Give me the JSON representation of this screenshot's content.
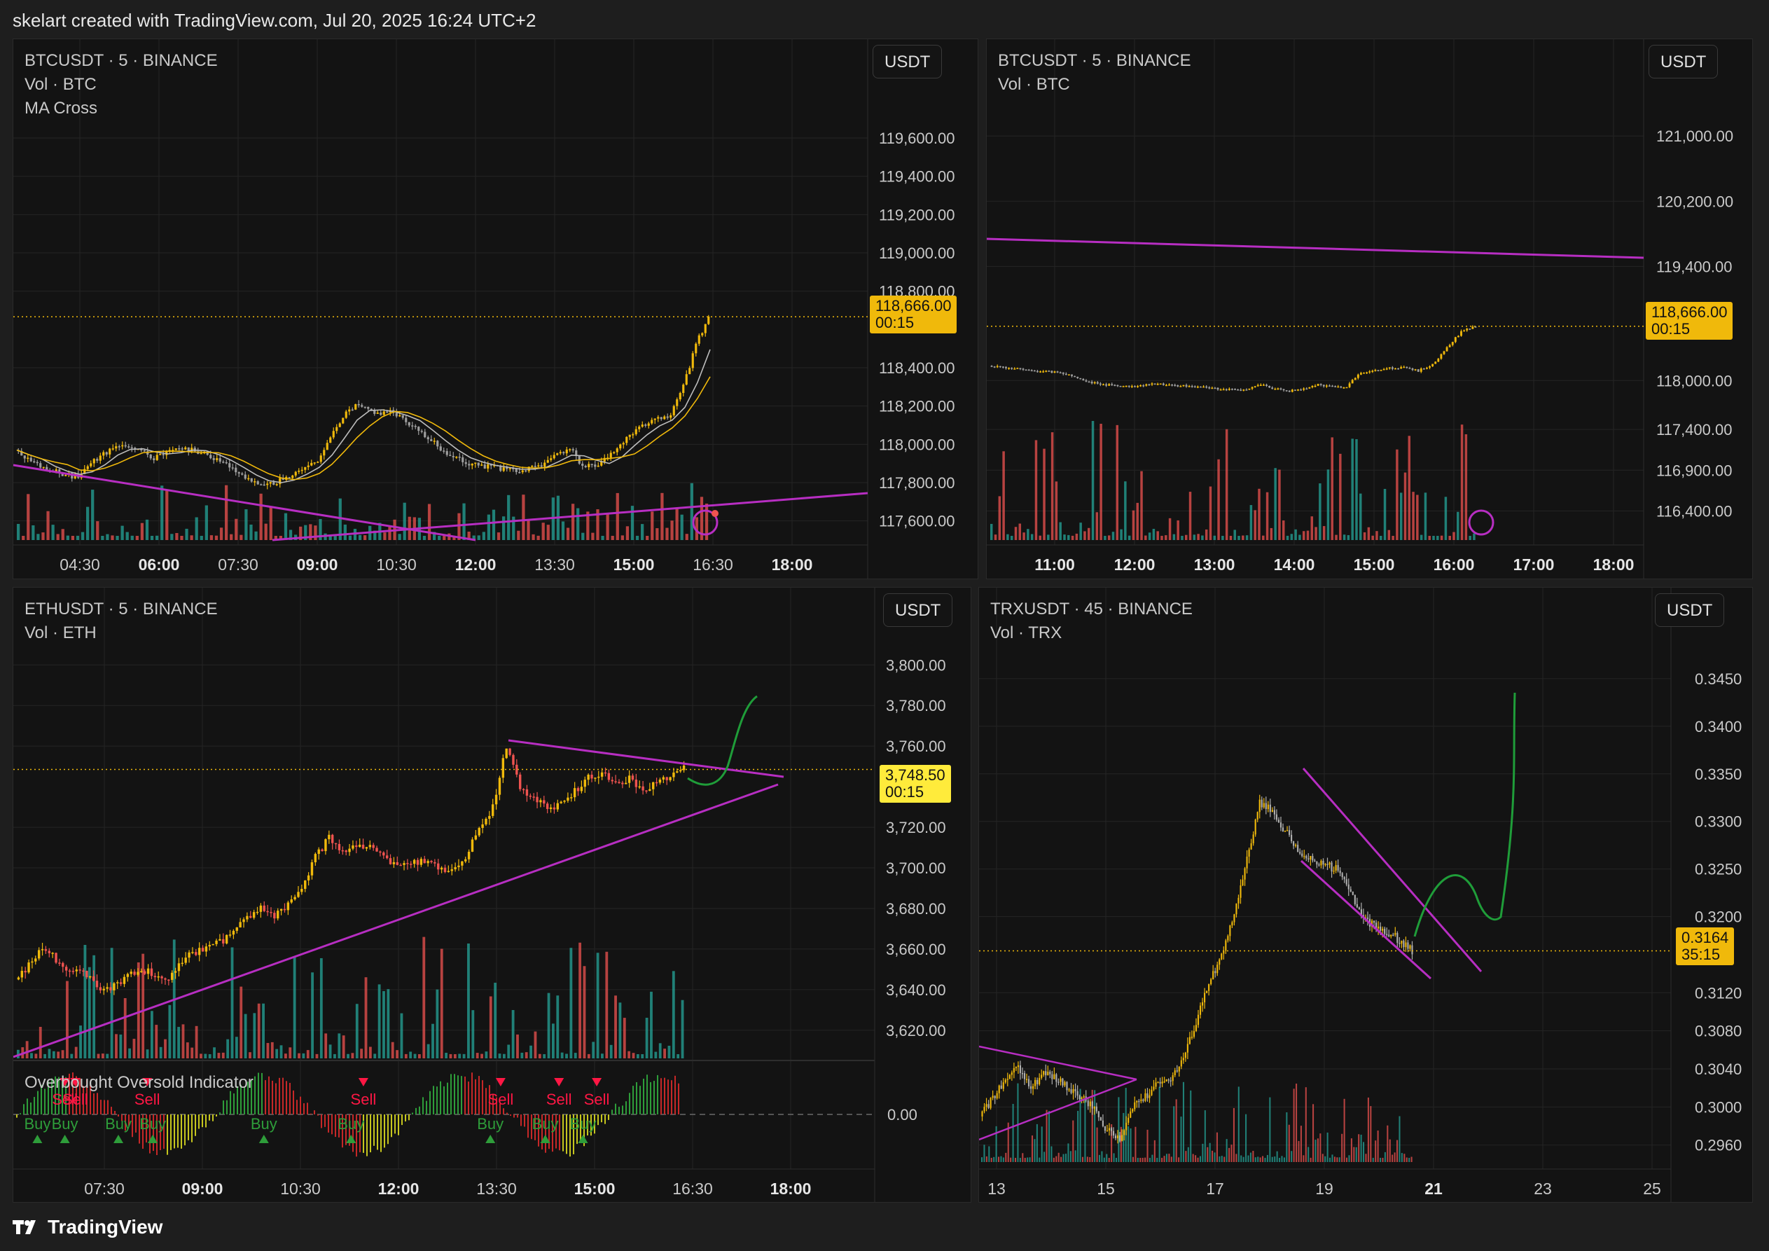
{
  "header": {
    "text": "skelart created with TradingView.com, Jul 20, 2025 16:24 UTC+2"
  },
  "footer": {
    "brand": "TradingView"
  },
  "colors": {
    "up": "#f0b90b",
    "down": "#ef5350",
    "trend": "#b72ec2",
    "green_path": "#1f9d39",
    "vol_up": "#26a69a",
    "vol_down": "#ef5350",
    "price_tag": "#f0b90b",
    "eth_tag": "#ffeb3b"
  },
  "panels": [
    {
      "id": "btc1",
      "legend": [
        "BTCUSDT · 5 · BINANCE",
        "Vol · BTC",
        "MA Cross"
      ],
      "unit": "USDT",
      "price": "118,666.00",
      "countdown": "00:15"
    },
    {
      "id": "btc2",
      "legend": [
        "BTCUSDT · 5 · BINANCE",
        "Vol · BTC"
      ],
      "unit": "USDT",
      "price": "118,666.00",
      "countdown": "00:15"
    },
    {
      "id": "eth",
      "legend": [
        "ETHUSDT · 5 · BINANCE",
        "Vol · ETH"
      ],
      "unit": "USDT",
      "price": "3,748.50",
      "countdown": "00:15",
      "oscillator_title": "Overbought Oversold Indicator",
      "oscillator_zero": "0.00"
    },
    {
      "id": "trx",
      "legend": [
        "TRXUSDT · 45 · BINANCE",
        "Vol · TRX"
      ],
      "unit": "USDT",
      "price": "0.3164",
      "countdown": "35:15"
    }
  ],
  "chart_data": [
    {
      "type": "candlestick",
      "symbol": "BTCUSDT",
      "interval": "5",
      "exchange": "BINANCE",
      "yticks": [
        "119,600.00",
        "119,400.00",
        "119,200.00",
        "119,000.00",
        "118,800.00",
        "118,400.00",
        "118,200.00",
        "118,000.00",
        "117,800.00",
        "117,600.00"
      ],
      "ylim": [
        117500,
        119750
      ],
      "xticks": [
        {
          "label": "04:30",
          "bold": false
        },
        {
          "label": "06:00",
          "bold": true
        },
        {
          "label": "07:30",
          "bold": false
        },
        {
          "label": "09:00",
          "bold": true
        },
        {
          "label": "10:30",
          "bold": false
        },
        {
          "label": "12:00",
          "bold": true
        },
        {
          "label": "13:30",
          "bold": false
        },
        {
          "label": "15:00",
          "bold": true
        },
        {
          "label": "16:30",
          "bold": false
        },
        {
          "label": "18:00",
          "bold": true
        }
      ],
      "last_price": 118666,
      "close_path": [
        117970,
        117920,
        117880,
        117860,
        117840,
        117830,
        117900,
        117950,
        117980,
        117990,
        117960,
        117930,
        117960,
        117980,
        117970,
        117950,
        117920,
        117880,
        117840,
        117800,
        117790,
        117810,
        117840,
        117880,
        117920,
        118030,
        118150,
        118200,
        118180,
        118160,
        118170,
        118120,
        118080,
        118020,
        117960,
        117930,
        117900,
        117890,
        117880,
        117870,
        117860,
        117880,
        117900,
        117950,
        117980,
        117890,
        117880,
        117930,
        117990,
        118060,
        118100,
        118130,
        118150,
        118300,
        118520,
        118666
      ]
    },
    {
      "type": "candlestick",
      "symbol": "BTCUSDT",
      "interval": "5",
      "exchange": "BINANCE",
      "yticks": [
        "121,000.00",
        "120,200.00",
        "119,400.00",
        "118,000.00",
        "117,400.00",
        "116,900.00",
        "116,400.00"
      ],
      "ylim": [
        116000,
        121500
      ],
      "xticks": [
        {
          "label": "11:00",
          "bold": true
        },
        {
          "label": "12:00",
          "bold": true
        },
        {
          "label": "13:00",
          "bold": true
        },
        {
          "label": "14:00",
          "bold": true
        },
        {
          "label": "15:00",
          "bold": true
        },
        {
          "label": "16:00",
          "bold": true
        },
        {
          "label": "17:00",
          "bold": true
        },
        {
          "label": "18:00",
          "bold": true
        }
      ],
      "last_price": 118666,
      "close_path": [
        118180,
        118160,
        118150,
        118120,
        118110,
        118100,
        118050,
        117980,
        117950,
        117940,
        117930,
        117950,
        117960,
        117940,
        117930,
        117920,
        117900,
        117890,
        117880,
        117950,
        117900,
        117870,
        117900,
        117950,
        117920,
        117930,
        118100,
        118130,
        118150,
        118160,
        118120,
        118200,
        118400,
        118600,
        118666
      ]
    },
    {
      "type": "candlestick",
      "symbol": "ETHUSDT",
      "interval": "5",
      "exchange": "BINANCE",
      "yticks": [
        "3,800.00",
        "3,780.00",
        "3,760.00",
        "3,720.00",
        "3,700.00",
        "3,680.00",
        "3,660.00",
        "3,640.00",
        "3,620.00"
      ],
      "ylim": [
        3612,
        3807
      ],
      "xticks": [
        {
          "label": "07:30",
          "bold": false
        },
        {
          "label": "09:00",
          "bold": true
        },
        {
          "label": "10:30",
          "bold": false
        },
        {
          "label": "12:00",
          "bold": true
        },
        {
          "label": "13:30",
          "bold": false
        },
        {
          "label": "15:00",
          "bold": true
        },
        {
          "label": "16:30",
          "bold": false
        },
        {
          "label": "18:00",
          "bold": true
        }
      ],
      "last_price": 3748.5,
      "close_path": [
        3645,
        3652,
        3660,
        3655,
        3650,
        3648,
        3642,
        3640,
        3645,
        3650,
        3648,
        3645,
        3652,
        3658,
        3660,
        3663,
        3668,
        3675,
        3680,
        3675,
        3683,
        3690,
        3705,
        3715,
        3708,
        3712,
        3710,
        3706,
        3700,
        3702,
        3704,
        3700,
        3698,
        3705,
        3720,
        3730,
        3760,
        3740,
        3735,
        3728,
        3732,
        3738,
        3744,
        3746,
        3741,
        3744,
        3738,
        3742,
        3745,
        3748.5
      ],
      "oscillator": {
        "title": "Overbought Oversold Indicator",
        "zero": "0.00",
        "signals": [
          {
            "type": "sell",
            "x": 0.07
          },
          {
            "type": "sell",
            "x": 0.085
          },
          {
            "type": "buy",
            "x": 0.03
          },
          {
            "type": "buy",
            "x": 0.07
          },
          {
            "type": "buy",
            "x": 0.148
          },
          {
            "type": "sell",
            "x": 0.19
          },
          {
            "type": "buy",
            "x": 0.198
          },
          {
            "type": "buy",
            "x": 0.36
          },
          {
            "type": "sell",
            "x": 0.505
          },
          {
            "type": "buy",
            "x": 0.487
          },
          {
            "type": "sell",
            "x": 0.705
          },
          {
            "type": "buy",
            "x": 0.69
          },
          {
            "type": "sell",
            "x": 0.79
          },
          {
            "type": "buy",
            "x": 0.77
          },
          {
            "type": "sell",
            "x": 0.845
          },
          {
            "type": "buy",
            "x": 0.825
          }
        ]
      }
    },
    {
      "type": "candlestick",
      "symbol": "TRXUSDT",
      "interval": "45",
      "exchange": "BINANCE",
      "yticks": [
        "0.3450",
        "0.3400",
        "0.3350",
        "0.3300",
        "0.3250",
        "0.3200",
        "0.3120",
        "0.3080",
        "0.3040",
        "0.3000",
        "0.2960"
      ],
      "ylim": [
        0.2948,
        0.3472
      ],
      "xticks": [
        {
          "label": "13",
          "bold": false
        },
        {
          "label": "15",
          "bold": false
        },
        {
          "label": "17",
          "bold": false
        },
        {
          "label": "19",
          "bold": false
        },
        {
          "label": "21",
          "bold": true
        },
        {
          "label": "23",
          "bold": false
        },
        {
          "label": "25",
          "bold": false
        }
      ],
      "last_price": 0.3164,
      "close_path": [
        0.299,
        0.301,
        0.303,
        0.304,
        0.302,
        0.3035,
        0.303,
        0.302,
        0.301,
        0.3,
        0.2975,
        0.2965,
        0.3,
        0.301,
        0.3025,
        0.303,
        0.305,
        0.309,
        0.313,
        0.316,
        0.32,
        0.326,
        0.332,
        0.331,
        0.329,
        0.327,
        0.326,
        0.3255,
        0.325,
        0.323,
        0.32,
        0.319,
        0.3185,
        0.3175,
        0.3164
      ]
    }
  ]
}
